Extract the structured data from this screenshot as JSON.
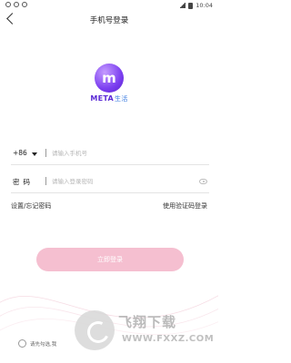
{
  "status_bar": {
    "time": "10:04"
  },
  "header": {
    "title": "手机号登录"
  },
  "brand": {
    "name": "META",
    "name_cn": "生活",
    "logo_glyph": "m"
  },
  "phone_field": {
    "country_code": "+86",
    "placeholder": "请输入手机号"
  },
  "password_field": {
    "label": "密码",
    "placeholder": "请输入登录密码"
  },
  "links": {
    "forgot": "设置/忘记密码",
    "sms_login": "使用验证码登录"
  },
  "login_button": {
    "label": "立即登录"
  },
  "agreement": {
    "text": "请先勾选,我"
  },
  "watermark": {
    "title": "飞翔下载",
    "url": "WWW.FXXZ.COM"
  },
  "colors": {
    "primary_button": "#f5bfd0",
    "brand_purple": "#7b3ef0",
    "brand_blue": "#3a7be0"
  },
  "icons": [
    "back-arrow-icon",
    "eye-icon",
    "dropdown-caret-icon"
  ]
}
